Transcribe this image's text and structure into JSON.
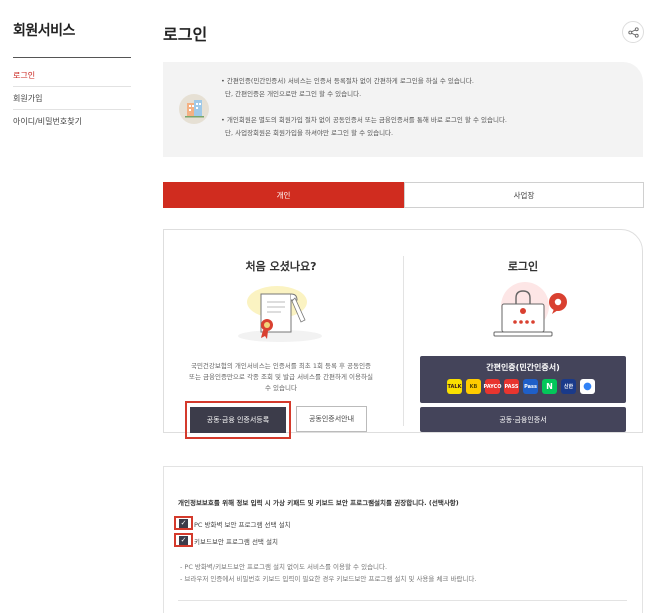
{
  "sidebar": {
    "title": "회원서비스",
    "items": [
      {
        "label": "로그인",
        "active": true
      },
      {
        "label": "회원가입",
        "active": false
      },
      {
        "label": "아이디/비밀번호찾기",
        "active": false
      }
    ]
  },
  "header": {
    "title": "로그인",
    "share_icon": "share-icon"
  },
  "notice": {
    "lines": [
      "• 간편인증(민간인증서) 서비스는 인증서 등록절차 없이 간편하게 로그인을 하실 수 있습니다.",
      "단, 간편인증은 개인으로만 로그인 할 수 있습니다.",
      "• 개인회원은 별도의 회원가입 절차 없이 공동인증서 또는 금융인증서를 통해 바로 로그인 할 수 있습니다.",
      "단, 사업장회원은 회원가입을 하셔야만 로그인 할 수 있습니다."
    ]
  },
  "tabs": [
    {
      "label": "개인",
      "active": true
    },
    {
      "label": "사업장",
      "active": false
    }
  ],
  "left_panel": {
    "title": "처음 오셨나요?",
    "desc": [
      "국민건강보험의 개인서비스는 인증서를 최초 1회 등록 후 공동인증",
      "또는 금융인증만으로 각종 조회 및 발급 서비스를 간편하게 이용하실",
      "수 있습니다"
    ],
    "register_button": "공동·금융 인증서등록",
    "guide_button": "공동인증서안내"
  },
  "right_panel": {
    "title": "로그인",
    "simple_auth_title": "간편인증(민간인증서)",
    "providers": [
      {
        "name": "kakao",
        "label": "TALK",
        "bg": "#f9e000",
        "fg": "#3a1d1d"
      },
      {
        "name": "kb",
        "label": "KB",
        "bg": "#ffcc00",
        "fg": "#5a4a00"
      },
      {
        "name": "payco",
        "label": "PAYCO",
        "bg": "#e8352f",
        "fg": "#ffffff"
      },
      {
        "name": "pass",
        "label": "PASS",
        "bg": "#e8352f",
        "fg": "#ffffff"
      },
      {
        "name": "samsung-pass",
        "label": "Pass",
        "bg": "#1f5fc8",
        "fg": "#ffffff"
      },
      {
        "name": "naver",
        "label": "N",
        "bg": "#03c75a",
        "fg": "#ffffff"
      },
      {
        "name": "shinhan",
        "label": "신한",
        "bg": "#1a3a8a",
        "fg": "#ffffff"
      },
      {
        "name": "toss",
        "label": "●",
        "bg": "#ffffff",
        "fg": "#3182f6"
      }
    ],
    "cert_login_button": "공동·금융인증서"
  },
  "security": {
    "heading": "개인정보보호를 위해 정보 입력 시 가상 키패드 및 키보드 보안 프로그램설치를 권장합니다. (선택사항)",
    "options": [
      {
        "label": "PC 방화벽 보안 프로그램 선택 설치",
        "checked": true
      },
      {
        "label": "키보드보안 프로그램 선택 설치",
        "checked": true
      }
    ],
    "notes": [
      "- PC 방화벽/키보드보안 프로그램 설치 없이도 서비스를 이용할 수 있습니다.",
      "- 브라우저 인증에서 비밀번호 키보드 입력이 필요한 경우 키보드보안 프로그램 설치 및 사용을 체크 바랍니다."
    ]
  },
  "colors": {
    "accent": "#d02c1f",
    "dark_button": "#44445a"
  }
}
